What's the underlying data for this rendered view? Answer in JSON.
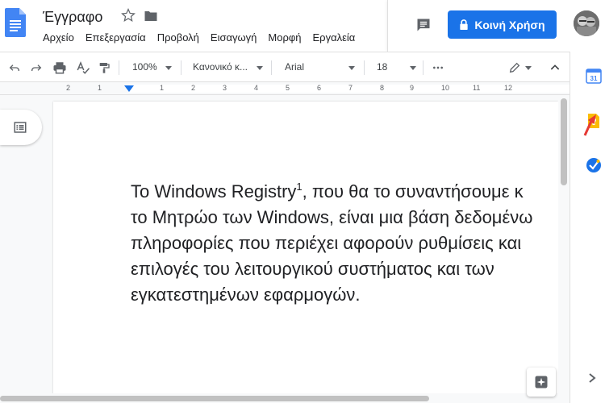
{
  "header": {
    "title": "Έγγραφο",
    "share_label": "Κοινή Χρήση",
    "menu": [
      "Αρχείο",
      "Επεξεργασία",
      "Προβολή",
      "Εισαγωγή",
      "Μορφή",
      "Εργαλεία"
    ]
  },
  "toolbar": {
    "zoom": "100%",
    "style": "Κανονικό κ...",
    "font": "Arial",
    "font_size": "18"
  },
  "ruler": {
    "numbers": [
      "2",
      "1",
      "1",
      "2",
      "3",
      "4",
      "5",
      "6",
      "7",
      "8",
      "9",
      "10",
      "11",
      "12"
    ]
  },
  "document": {
    "lines": [
      "Το Windows Registry",
      "το Μητρώο των Windows, είναι μια βάση δεδομένω",
      "πληροφορίες που περιέχει αφορούν ρυθμίσεις και",
      "επιλογές του λειτουργικού συστήματος και των",
      "εγκατεστημένων εφαρμογών."
    ],
    "footnote_ref": "1",
    "line1_rest": ", που θα το συναντήσουμε κ"
  },
  "side_panel": {
    "calendar_day": "31"
  },
  "colors": {
    "accent": "#1a73e8",
    "keep": "#fbbc04",
    "tasks": "#1a73e8",
    "arrow": "#e53935"
  }
}
